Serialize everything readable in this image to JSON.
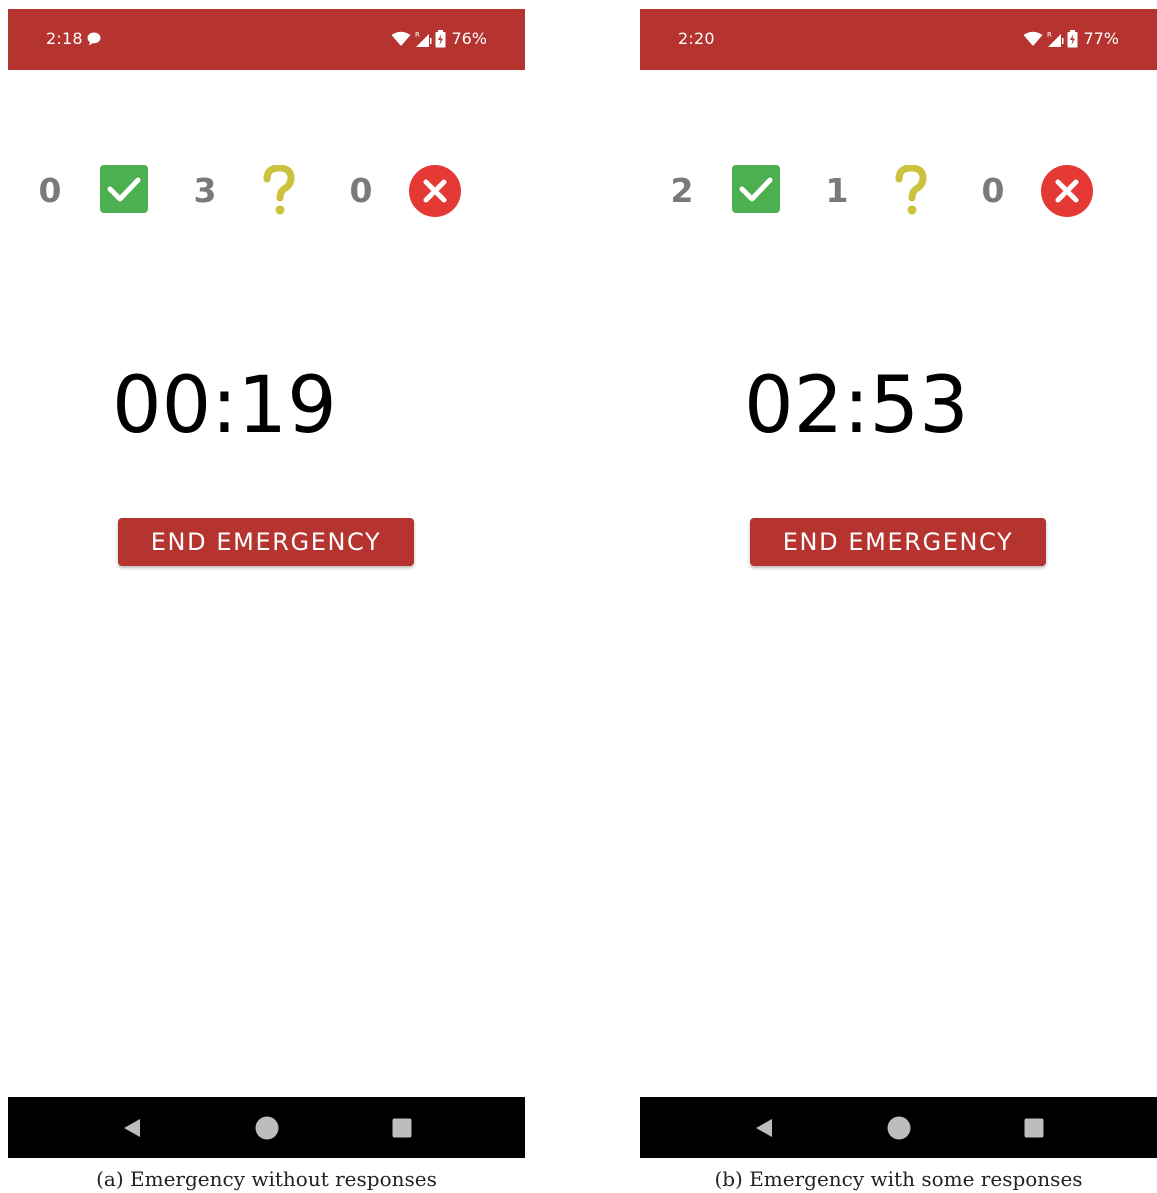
{
  "panels": [
    {
      "status": {
        "time": "2:18",
        "battery": "76%",
        "has_message_icon": true
      },
      "counts": {
        "accepted": "0",
        "pending": "3",
        "declined": "0"
      },
      "timer": "00:19",
      "button_label": "END EMERGENCY",
      "caption": "(a) Emergency without responses"
    },
    {
      "status": {
        "time": "2:20",
        "battery": "77%",
        "has_message_icon": false
      },
      "counts": {
        "accepted": "2",
        "pending": "1",
        "declined": "0"
      },
      "timer": "02:53",
      "button_label": "END EMERGENCY",
      "caption": "(b) Emergency with some responses"
    }
  ],
  "icons": {
    "accepted": "checkbox-check-icon",
    "pending": "question-mark-icon",
    "declined": "circle-x-icon",
    "nav_back": "back-triangle-icon",
    "nav_home": "home-circle-icon",
    "nav_recents": "recents-square-icon"
  },
  "colors": {
    "status_bar": "#b53430",
    "button": "#b53430",
    "accepted": "#4caf50",
    "pending": "#cdc23e",
    "declined": "#e53935",
    "count_text": "#7a7a7a",
    "nav_bar": "#000000"
  }
}
